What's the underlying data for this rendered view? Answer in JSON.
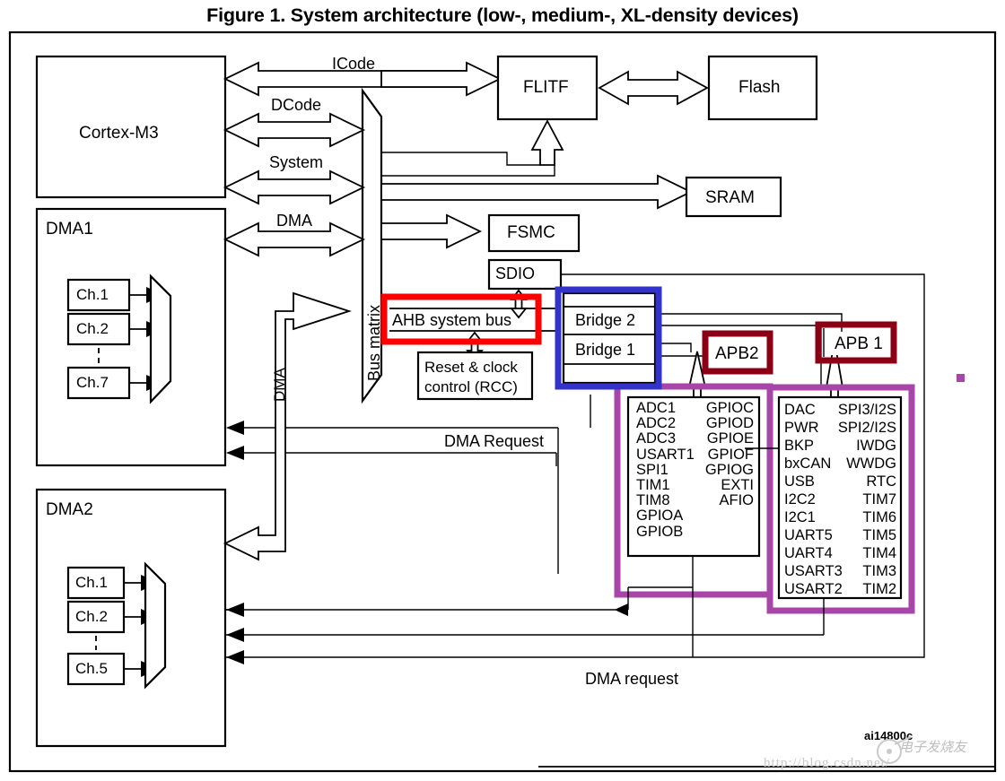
{
  "figure": {
    "title": "Figure 1. System architecture (low-, medium-, XL-density devices)",
    "id_code": "ai14800c"
  },
  "colors": {
    "highlight_red": "#FF0000",
    "highlight_blue": "#3333CC",
    "highlight_darkred": "#8B0015",
    "highlight_purple": "#A845A8",
    "line": "#000000",
    "background": "#FFFFFF"
  },
  "blocks": {
    "cortex": "Cortex-M3",
    "dma1": "DMA1",
    "dma2": "DMA2",
    "bus_matrix": "Bus matrix",
    "flitf": "FLITF",
    "flash": "Flash",
    "sram": "SRAM",
    "fsmc": "FSMC",
    "sdio": "SDIO",
    "ahb_bus": "AHB system bus",
    "rcc": "Reset & clock control (RCC)",
    "rcc_line1": "Reset & clock",
    "rcc_line2": "control (RCC)",
    "bridge2": "Bridge  2",
    "bridge1": "Bridge  1",
    "apb2": "APB2",
    "apb1": "APB 1"
  },
  "bus_labels": {
    "icode": "ICode",
    "dcode": "DCode",
    "system": "System",
    "dma_top": "DMA",
    "dma_vertical": "DMA",
    "dma_request_mid": "DMA Request",
    "dma_request_bottom": "DMA request"
  },
  "dma1_channels": [
    "Ch.1",
    "Ch.2",
    "Ch.7"
  ],
  "dma2_channels": [
    "Ch.1",
    "Ch.2",
    "Ch.5"
  ],
  "apb2_peripherals": {
    "left": [
      "ADC1",
      "ADC2",
      "ADC3",
      "USART1",
      "SPI1",
      "TIM1",
      "TIM8",
      "GPIOA",
      "GPIOB"
    ],
    "right": [
      "GPIOC",
      "GPIOD",
      "GPIOE",
      "GPIOF",
      "GPIOG",
      "EXTI",
      "AFIO"
    ]
  },
  "apb1_peripherals": {
    "left": [
      "DAC",
      "PWR",
      "BKP",
      "bxCAN",
      "USB",
      "I2C2",
      "I2C1",
      "UART5",
      "UART4",
      "USART3",
      "USART2"
    ],
    "right": [
      "SPI3/I2S",
      "SPI2/I2S",
      "IWDG",
      "WWDG",
      "RTC",
      "TIM7",
      "TIM6",
      "TIM5",
      "TIM4",
      "TIM3",
      "TIM2"
    ]
  },
  "watermarks": {
    "url": "http://blog.csdn.net/",
    "brand": "电子发烧友"
  }
}
